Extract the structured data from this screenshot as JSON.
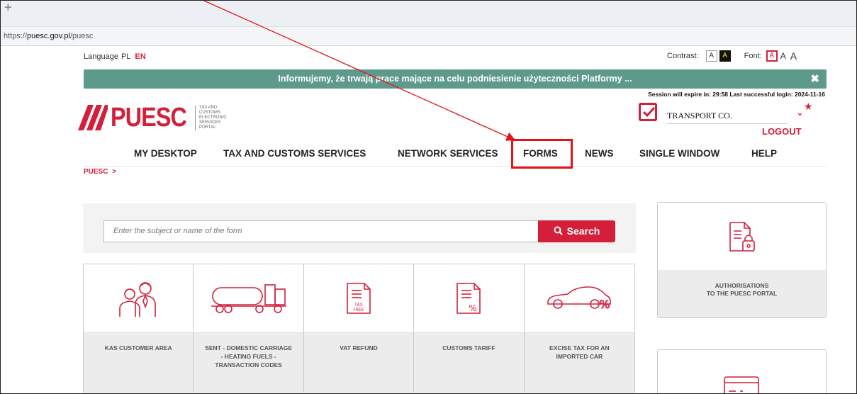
{
  "browser": {
    "new_tab_glyph": "+",
    "url_prefix": "https://",
    "url_host": "puesc.gov.pl",
    "url_path": "/puesc"
  },
  "topbar": {
    "language_label": "Language",
    "lang_pl": "PL",
    "lang_en": "EN",
    "contrast_label": "Contrast:",
    "contrast_normal": "A",
    "contrast_high": "A",
    "font_label": "Font:",
    "font_small": "A",
    "font_medium": "A",
    "font_large": "A"
  },
  "banner": {
    "text": "Informujemy, że trwają prace mające na celu podniesienie użyteczności Platformy ...",
    "close_glyph": "✖"
  },
  "session": {
    "text": "Session will expire in: 29:58   Last successful login: 2024-11-16"
  },
  "logo": {
    "word": "PUESC",
    "tagline_1": "TAX AND CUSTOMS",
    "tagline_2": "ELECTRONIC",
    "tagline_3": "SERVICES",
    "tagline_4": "PORTAL"
  },
  "account": {
    "name": "TRANSPORT CO.",
    "chevron": "⌄",
    "favorite": "★",
    "logout": "LOGOUT"
  },
  "nav": {
    "items": [
      "MY DESKTOP",
      "TAX AND CUSTOMS SERVICES",
      "NETWORK SERVICES",
      "FORMS",
      "NEWS",
      "SINGLE WINDOW",
      "HELP"
    ]
  },
  "breadcrumb": {
    "root": "PUESC",
    "sep": ">"
  },
  "search": {
    "placeholder": "Enter the subject or name of the form",
    "button": "Search"
  },
  "tiles": [
    {
      "label": "KAS CUSTOMER AREA",
      "icon": "customers-icon"
    },
    {
      "label": "SENT - DOMESTIC CARRIAGE - HEATING FUELS - TRANSACTION CODES",
      "icon": "tanker-truck-icon"
    },
    {
      "label": "VAT REFUND",
      "icon": "tax-free-document-icon"
    },
    {
      "label": "CUSTOMS TARIFF",
      "icon": "percent-document-icon"
    },
    {
      "label": "EXCISE TAX FOR AN IMPORTED CAR",
      "icon": "car-percent-icon"
    }
  ],
  "side_tiles": [
    {
      "label_line1": "AUTHORISATIONS",
      "label_line2": "TO THE PUESC PORTAL",
      "icon": "locked-document-icon"
    },
    {
      "icon": "payment-card-icon"
    }
  ],
  "colors": {
    "brand_red": "#d31f3a",
    "banner_teal": "#5e9a8c",
    "highlight_box": "#e3141a"
  }
}
